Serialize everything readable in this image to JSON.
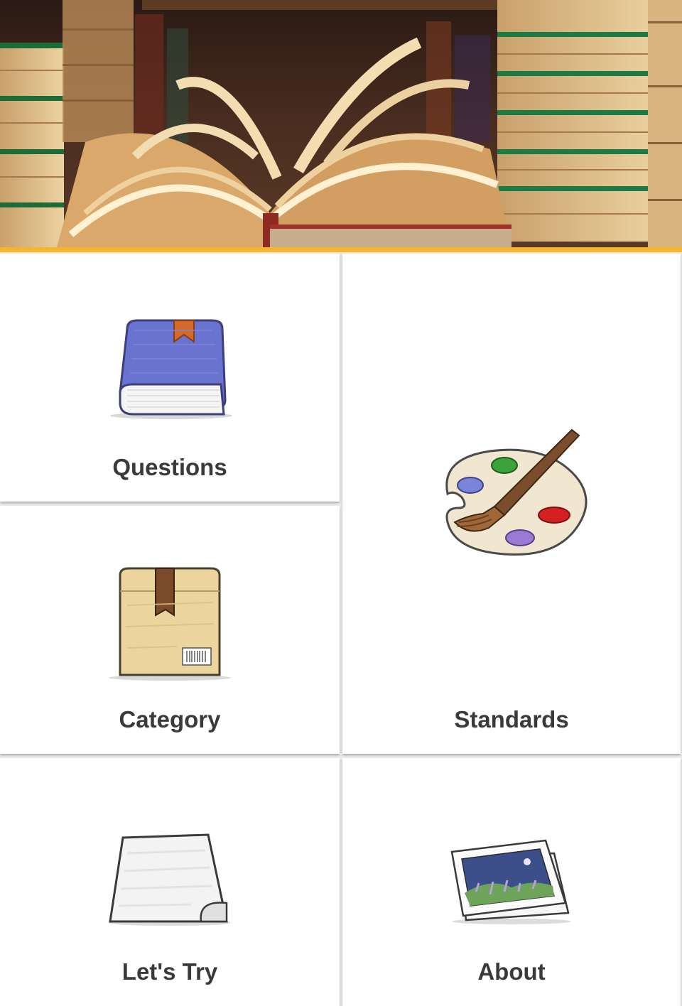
{
  "theme": {
    "accent": "#f6b52a",
    "tile_background": "#ffffff",
    "page_background": "#ececec",
    "label_color": "#3a3a3a"
  },
  "header": {
    "image": "open-books-banner"
  },
  "menu": {
    "questions": {
      "label": "Questions",
      "icon": "book-icon"
    },
    "standards": {
      "label": "Standards",
      "icon": "paint-palette-icon"
    },
    "category": {
      "label": "Category",
      "icon": "package-box-icon"
    },
    "lets_try": {
      "label": "Let's Try",
      "icon": "blank-paper-icon"
    },
    "about": {
      "label": "About",
      "icon": "photos-icon"
    }
  }
}
